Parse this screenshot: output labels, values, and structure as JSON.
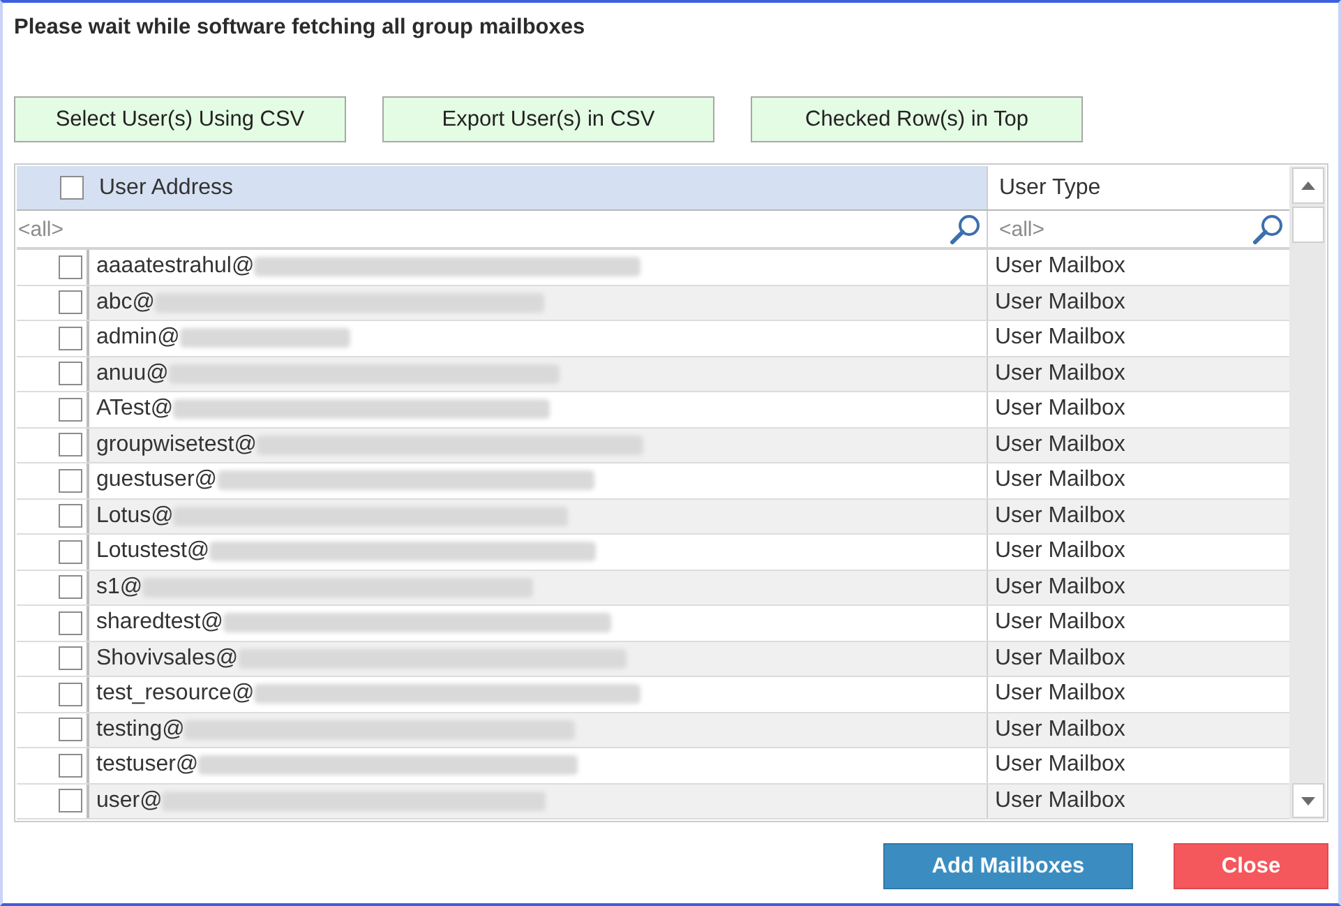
{
  "title": "Please wait while software fetching all group mailboxes",
  "buttons": [
    {
      "label": "Select User(s) Using CSV"
    },
    {
      "label": "Export User(s) in CSV"
    },
    {
      "label": "Checked Row(s) in Top"
    }
  ],
  "table": {
    "select_all": {
      "checked": false
    },
    "columns": [
      {
        "label": "User Address",
        "highlighted": true
      },
      {
        "label": "User Type",
        "highlighted": false
      }
    ],
    "filters": [
      {
        "placeholder": "<all>"
      },
      {
        "placeholder": "<all>"
      }
    ],
    "rows": [
      {
        "address": "aaaatestrahul@",
        "redacted": true,
        "type": "User Mailbox",
        "checked": false
      },
      {
        "address": "abc@",
        "redacted": true,
        "type": "User Mailbox",
        "checked": false
      },
      {
        "address": "admin@",
        "redacted": true,
        "type": "User Mailbox",
        "checked": false
      },
      {
        "address": "anuu@",
        "redacted": true,
        "type": "User Mailbox",
        "checked": false
      },
      {
        "address": "ATest@",
        "redacted": true,
        "type": "User Mailbox",
        "checked": false
      },
      {
        "address": "groupwisetest@",
        "redacted": true,
        "type": "User Mailbox",
        "checked": false
      },
      {
        "address": "guestuser@",
        "redacted": true,
        "type": "User Mailbox",
        "checked": false
      },
      {
        "address": "Lotus@",
        "redacted": true,
        "type": "User Mailbox",
        "checked": false
      },
      {
        "address": "Lotustest@",
        "redacted": true,
        "type": "User Mailbox",
        "checked": false
      },
      {
        "address": "s1@",
        "redacted": true,
        "type": "User Mailbox",
        "checked": false
      },
      {
        "address": "sharedtest@",
        "redacted": true,
        "type": "User Mailbox",
        "checked": false
      },
      {
        "address": "Shovivsales@",
        "redacted": true,
        "type": "User Mailbox",
        "checked": false
      },
      {
        "address": "test_resource@",
        "redacted": true,
        "type": "User Mailbox",
        "checked": false
      },
      {
        "address": "testing@",
        "redacted": true,
        "type": "User Mailbox",
        "checked": false
      },
      {
        "address": "testuser@",
        "redacted": true,
        "type": "User Mailbox",
        "checked": false
      },
      {
        "address": "user@",
        "redacted": true,
        "type": "User Mailbox",
        "checked": false
      }
    ]
  },
  "actions": [
    {
      "label": "Add Mailboxes",
      "kind": "primary"
    },
    {
      "label": "Close",
      "kind": "danger"
    }
  ]
}
